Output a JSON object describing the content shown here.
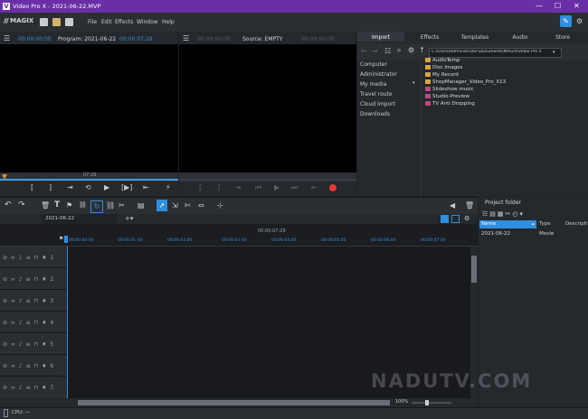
{
  "app": {
    "title": "Video Pro X - 2021-06-22.MVP",
    "brand": "MAGIX"
  },
  "window_controls": {
    "minimize": "—",
    "maximize": "☐",
    "close": "✕"
  },
  "menu": [
    "File",
    "Edit",
    "Effects",
    "Window",
    "Help"
  ],
  "program_monitor": {
    "timecode_left": "00:00:00:00",
    "label": "Program: 2021-06-22",
    "timecode_right": "00:00:07:29",
    "scrub_time": "07:29",
    "controls": [
      "[",
      "]",
      "⇥",
      "⟲",
      "▶",
      "[▶]",
      "⇤",
      "⚡"
    ]
  },
  "source_monitor": {
    "timecode_left": "00:00:00:00",
    "label": "Source: EMPTY",
    "timecode_right": "00:00:00:00"
  },
  "media_pool": {
    "tabs": [
      "Import",
      "Effects",
      "Templates",
      "Audio",
      "Store"
    ],
    "active_tab": "Import",
    "path": "C:\\Users\\Administrator\\Documents\\MAGIX\\Video Pro X",
    "sidebar": [
      "Computer",
      "Administrator",
      "My media",
      "Travel route",
      "Cloud Import",
      "Downloads"
    ],
    "files": [
      {
        "name": "AudioTemp",
        "type": "folder"
      },
      {
        "name": "Disc Images",
        "type": "folder"
      },
      {
        "name": "My Record",
        "type": "folder"
      },
      {
        "name": "ShopManager_Video_Pro_X13",
        "type": "folder"
      },
      {
        "name": "Slideshow music",
        "type": "media"
      },
      {
        "name": "Studio-Preview",
        "type": "media"
      },
      {
        "name": "TV Anti Dropping",
        "type": "media"
      }
    ]
  },
  "timeline": {
    "project_tab": "2021-06-22",
    "position": "00:00:07:29",
    "ruler": [
      "00:00:00:00",
      "00:00:01:00",
      "00:00:02:00",
      "00:00:03:00",
      "00:00:04:00",
      "00:00:05:00",
      "00:00:06:00",
      "00:00:07:00"
    ],
    "tracks": [
      {
        "num": "1"
      },
      {
        "num": "2"
      },
      {
        "num": "3"
      },
      {
        "num": "4"
      },
      {
        "num": "5"
      },
      {
        "num": "6"
      },
      {
        "num": "7"
      }
    ],
    "zoom": "100%",
    "status": "CPU: —"
  },
  "project_folder": {
    "title": "Project folder",
    "columns": [
      "Name",
      "Type",
      "Descripti"
    ],
    "rows": [
      {
        "name": "2021-06-22",
        "type": "Movie",
        "desc": ""
      }
    ]
  },
  "watermark": "NADUTV.COM",
  "colors": {
    "accent": "#2e8fe0",
    "titlebar": "#6a2fa6",
    "record": "#e53935",
    "playhead": "#e8892b"
  }
}
